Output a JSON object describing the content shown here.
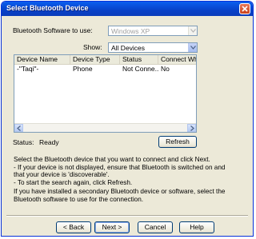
{
  "window": {
    "title": "Select Bluetooth Device"
  },
  "software": {
    "label": "Bluetooth Software to use:",
    "value": "Windows XP"
  },
  "show": {
    "label": "Show:",
    "value": "All Devices"
  },
  "device_list": {
    "columns": [
      "Device Name",
      "Device Type",
      "Status",
      "Connect When"
    ],
    "rows": [
      [
        "-\"Taqi\"-",
        "Phone",
        "Not Conne...",
        "No"
      ]
    ]
  },
  "status": {
    "label": "Status:",
    "value": "Ready",
    "refresh_label": "Refresh"
  },
  "instructions": {
    "line1": "Select the Bluetooth device that you want to connect and click Next.",
    "line2": "- If your device is not displayed, ensure that Bluetooth is switched on and",
    "line3": "that your device is 'discoverable'.",
    "line4": "- To start the search again, click Refresh.",
    "line5": "If you have installed a secondary Bluetooth device or software, select the",
    "line6": "Bluetooth software to use for the connection."
  },
  "footer": {
    "back_label": "< Back",
    "next_label": "Next >",
    "cancel_label": "Cancel",
    "help_label": "Help"
  }
}
